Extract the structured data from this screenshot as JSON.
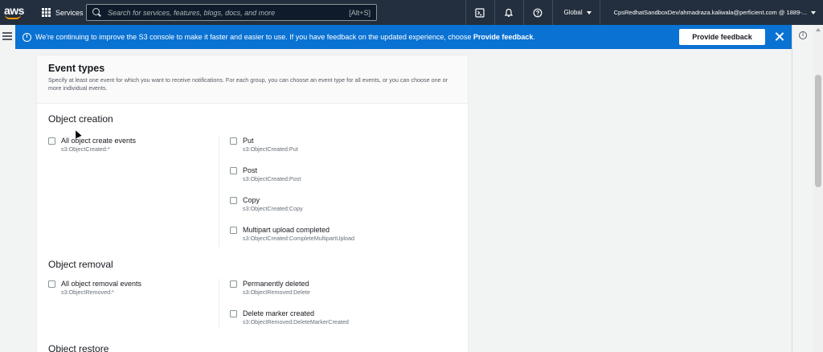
{
  "topnav": {
    "logo": "aws",
    "services_label": "Services",
    "search_placeholder": "Search for services, features, blogs, docs, and more",
    "search_shortcut": "[Alt+S]",
    "region_label": "Global",
    "account_label": "CpsRedhatSandboxDev/ahmadraza.kaliwala@perficient.com @ 1889-..."
  },
  "banner": {
    "text_prefix": "We're continuing to improve the S3 console to make it faster and easier to use. If you have feedback on the updated experience, choose ",
    "text_link": "Provide feedback",
    "text_suffix": ".",
    "feedback_button": "Provide feedback"
  },
  "event_types": {
    "title": "Event types",
    "description": "Specify at least one event for which you want to receive notifications. For each group, you can choose an event type for all events, or you can choose one or more individual events.",
    "groups": [
      {
        "title": "Object creation",
        "all": {
          "label": "All object create events",
          "code": "s3:ObjectCreated:*"
        },
        "items": [
          {
            "label": "Put",
            "code": "s3:ObjectCreated:Put"
          },
          {
            "label": "Post",
            "code": "s3:ObjectCreated:Post"
          },
          {
            "label": "Copy",
            "code": "s3:ObjectCreated:Copy"
          },
          {
            "label": "Multipart upload completed",
            "code": "s3:ObjectCreated:CompleteMultipartUpload"
          }
        ]
      },
      {
        "title": "Object removal",
        "all": {
          "label": "All object removal events",
          "code": "s3:ObjectRemoved:*"
        },
        "items": [
          {
            "label": "Permanently deleted",
            "code": "s3:ObjectRemoved:Delete"
          },
          {
            "label": "Delete marker created",
            "code": "s3:ObjectRemoved:DeleteMarkerCreated"
          }
        ]
      },
      {
        "title": "Object restore"
      }
    ]
  }
}
